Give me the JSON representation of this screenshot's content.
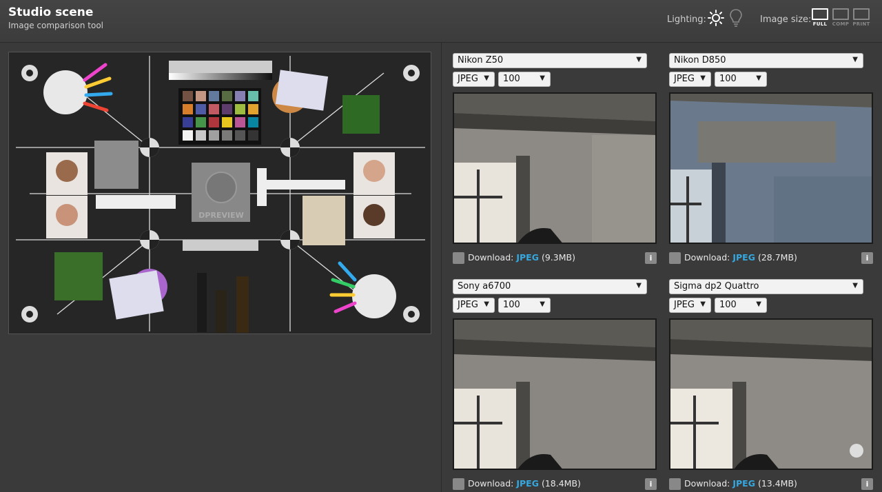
{
  "header": {
    "title": "Studio scene",
    "subtitle": "Image comparison tool",
    "lighting_label": "Lighting:",
    "image_size_label": "Image size:",
    "size_options": [
      "FULL",
      "COMP",
      "PRINT"
    ],
    "selected_size": "FULL",
    "icons": [
      "sun-icon",
      "bulb-icon"
    ]
  },
  "scene": {
    "labels": [
      "DPREVIEW"
    ]
  },
  "panels": [
    {
      "camera": "Nikon Z50",
      "format": "JPEG",
      "iso": "100",
      "download_label": "Download:",
      "download_format": "JPEG",
      "size": "(9.3MB)",
      "info": "i"
    },
    {
      "camera": "Nikon D850",
      "format": "JPEG",
      "iso": "100",
      "download_label": "Download:",
      "download_format": "JPEG",
      "size": "(28.7MB)",
      "info": "i"
    },
    {
      "camera": "Sony a6700",
      "format": "JPEG",
      "iso": "100",
      "download_label": "Download:",
      "download_format": "JPEG",
      "size": "(18.4MB)",
      "info": "i"
    },
    {
      "camera": "Sigma dp2 Quattro",
      "format": "JPEG",
      "iso": "100",
      "download_label": "Download:",
      "download_format": "JPEG",
      "size": "(13.4MB)",
      "info": "i"
    }
  ],
  "colors": {
    "accent": "#35a8e0",
    "background": "#3a3a3a",
    "header": "#444444"
  }
}
